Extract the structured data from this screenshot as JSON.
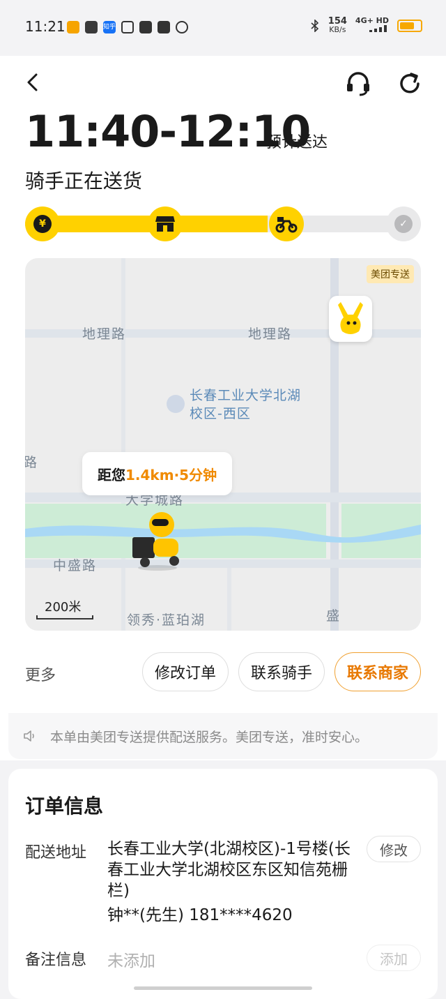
{
  "status_bar": {
    "time": "11:21",
    "speed_value": "154",
    "speed_unit": "KB/s",
    "network": "4G+ HD",
    "app_icons": [
      "meituan-icon",
      "link-icon",
      "zhihu-icon",
      "doc-icon",
      "mail-icon",
      "telegram-icon",
      "browser-icon"
    ],
    "zhihu_label": "知乎"
  },
  "header": {
    "eta_time": "11:40-12:10",
    "eta_label": "预计送达",
    "status": "骑手正在送货"
  },
  "progress": {
    "steps": [
      "order-paid-icon",
      "store-icon",
      "rider-icon",
      "delivered-check-icon"
    ],
    "current_step": 3,
    "fill_fraction": 0.75,
    "step1_glyph": "¥"
  },
  "map": {
    "brand_tag": "美团专送",
    "roads": [
      "地理路",
      "地理路",
      "大学城路",
      "中盛路",
      "领秀·蓝珀湖",
      "盛"
    ],
    "left_edge_label": "路",
    "campus_name_line1": "长春工业大学北湖",
    "campus_name_line2": "校区-西区",
    "distance_prefix": "距您",
    "distance_value": "1.4km·5分钟",
    "scale": "200米"
  },
  "actions": {
    "more": "更多",
    "modify_order": "修改订单",
    "contact_rider": "联系骑手",
    "contact_merchant": "联系商家"
  },
  "notice": "本单由美团专送提供配送服务。美团专送，准时安心。",
  "order": {
    "title": "订单信息",
    "address_label": "配送地址",
    "address": "长春工业大学(北湖校区)-1号楼(长春工业大学北湖校区东区知信苑栅栏)",
    "contact": "钟**(先生) 181****4620",
    "modify": "修改",
    "note_label": "备注信息",
    "note_value": "未添加",
    "add": "添加"
  },
  "colors": {
    "accent_yellow": "#ffd100",
    "accent_orange": "#e87800"
  }
}
